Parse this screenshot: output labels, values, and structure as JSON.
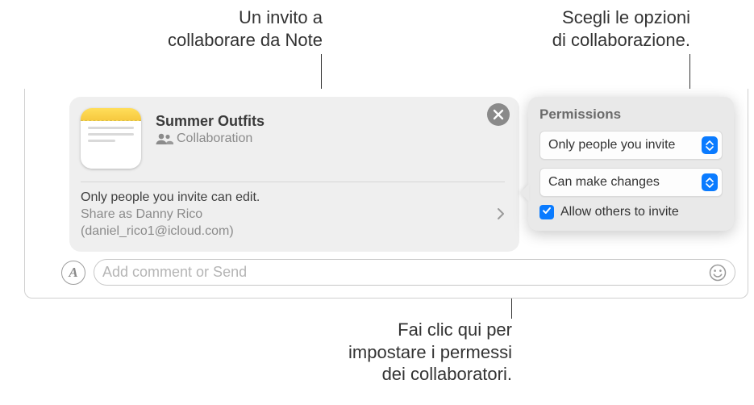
{
  "callouts": {
    "invite": "Un invito a\ncollaborare da Note",
    "options": "Scegli le opzioni\ndi collaborazione.",
    "permissions": "Fai clic qui per\nimpostare i permessi\ndei collaboratori."
  },
  "card": {
    "title": "Summer Outfits",
    "subtitle": "Collaboration",
    "permission_line": "Only people you invite can edit.",
    "share_as_label": "Share as Danny Rico",
    "share_email": "(daniel_rico1@icloud.com)"
  },
  "popover": {
    "title": "Permissions",
    "who": "Only people you invite",
    "access": "Can make changes",
    "allow_invite": "Allow others to invite"
  },
  "input": {
    "placeholder": "Add comment or Send"
  },
  "icons": {
    "close": "close-icon",
    "people": "people-icon",
    "apps": "A",
    "emoji": "emoji-icon"
  },
  "colors": {
    "accent": "#0a7bff",
    "notes_yellow": "#f7c93f"
  }
}
